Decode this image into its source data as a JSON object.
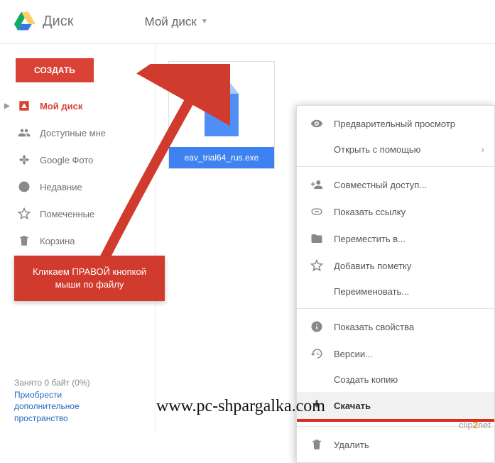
{
  "app": {
    "name": "Диск"
  },
  "breadcrumb": {
    "label": "Мой диск"
  },
  "sidebar": {
    "create_label": "СОЗДАТЬ",
    "items": [
      {
        "label": "Мой диск"
      },
      {
        "label": "Доступные мне"
      },
      {
        "label": "Google Фото"
      },
      {
        "label": "Недавние"
      },
      {
        "label": "Помеченные"
      },
      {
        "label": "Корзина"
      }
    ]
  },
  "callout": {
    "line1": "Кликаем ПРАВОЙ кнопкой",
    "line2": "мыши по файлу"
  },
  "storage": {
    "status": "Занято 0 байт (0%)",
    "link1": "Приобрести",
    "link2": "дополнительное",
    "link3": "пространство"
  },
  "file": {
    "name": "eav_trial64_rus.exe"
  },
  "menu": {
    "preview": "Предварительный просмотр",
    "open_with": "Открыть с помощью",
    "share": "Совместный доступ...",
    "get_link": "Показать ссылку",
    "move_to": "Переместить в...",
    "add_star": "Добавить пометку",
    "rename": "Переименовать...",
    "properties": "Показать свойства",
    "versions": "Версии...",
    "make_copy": "Создать копию",
    "download": "Скачать",
    "delete": "Удалить"
  },
  "watermark": "www.pc-shpargalka.com",
  "clip2net": {
    "a": "clip",
    "b": "2",
    "c": "net"
  }
}
